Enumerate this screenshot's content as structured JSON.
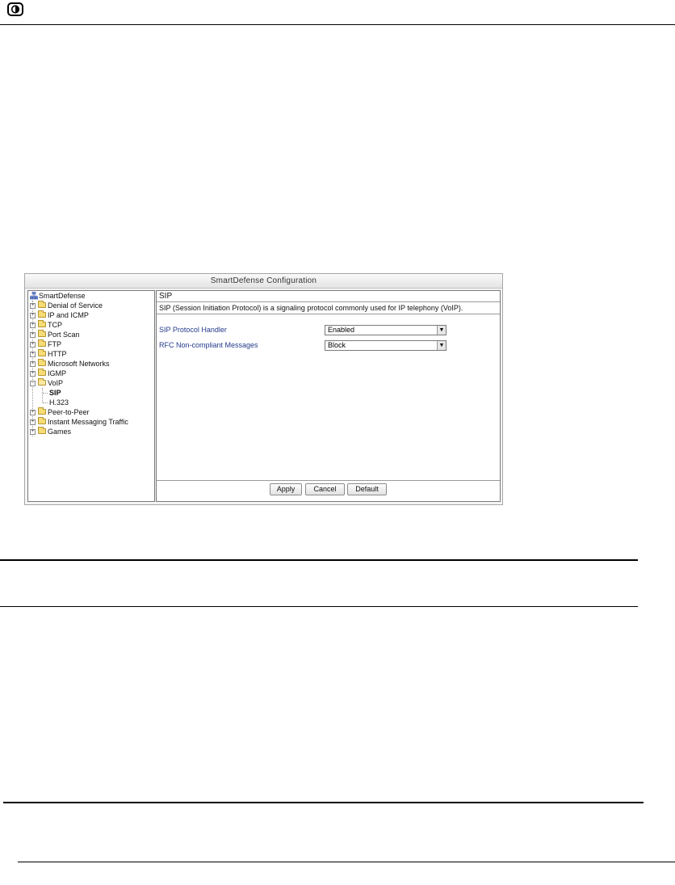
{
  "logo": {
    "icon": "circle-logo-icon"
  },
  "window": {
    "title": "SmartDefense Configuration",
    "tree": {
      "root": "SmartDefense",
      "items": [
        {
          "label": "Denial of Service",
          "expanded": false
        },
        {
          "label": "IP and ICMP",
          "expanded": false
        },
        {
          "label": "TCP",
          "expanded": false
        },
        {
          "label": "Port Scan",
          "expanded": false
        },
        {
          "label": "FTP",
          "expanded": false
        },
        {
          "label": "HTTP",
          "expanded": false
        },
        {
          "label": "Microsoft Networks",
          "expanded": false
        },
        {
          "label": "IGMP",
          "expanded": false
        },
        {
          "label": "VoIP",
          "expanded": true,
          "children": [
            "SIP",
            "H.323"
          ]
        },
        {
          "label": "Peer-to-Peer",
          "expanded": false
        },
        {
          "label": "Instant Messaging Traffic",
          "expanded": false
        },
        {
          "label": "Games",
          "expanded": false
        }
      ]
    },
    "panel": {
      "header": "SIP",
      "description": "SIP (Session Initiation Protocol) is a signaling protocol commonly used for IP telephony (VoIP).",
      "fields": [
        {
          "label": "SIP Protocol Handler",
          "value": "Enabled"
        },
        {
          "label": "RFC Non-compliant Messages",
          "value": "Block"
        }
      ],
      "buttons": {
        "apply": "Apply",
        "cancel": "Cancel",
        "default": "Default"
      }
    }
  }
}
